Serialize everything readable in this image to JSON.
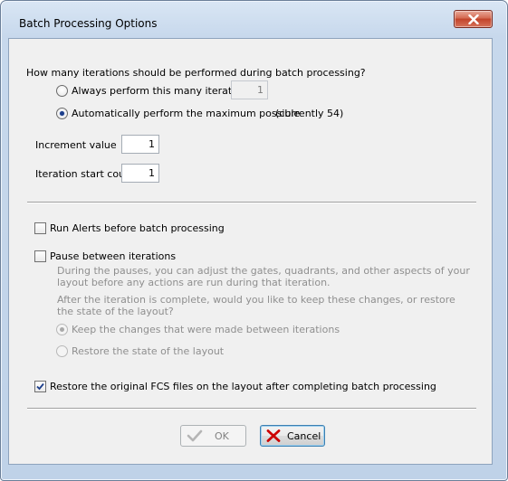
{
  "window": {
    "title": "Batch Processing Options"
  },
  "iterations": {
    "question": "How many iterations should be performed during batch processing?",
    "always_label": "Always perform this many iterations:",
    "always_value": "1",
    "auto_label": "Automatically perform the maximum possible",
    "auto_note": "(currently 54)",
    "selected": "auto"
  },
  "increment": {
    "label": "Increment value",
    "value": "1"
  },
  "start_count": {
    "label": "Iteration start count",
    "value": "1"
  },
  "alerts": {
    "label": "Run Alerts before batch processing",
    "checked": false
  },
  "pause": {
    "label": "Pause between iterations",
    "checked": false,
    "desc_line1": "During the pauses, you can adjust the gates, quadrants, and other aspects of your",
    "desc_line2": "layout before any actions are run during that iteration.",
    "desc_line3": "After the iteration is complete, would you like to keep these changes, or restore",
    "desc_line4": "the state of the layout?",
    "keep_label": "Keep the changes that were made between iterations",
    "restore_label": "Restore the state of the layout"
  },
  "restore_fcs": {
    "label": "Restore the original FCS files on the layout after completing batch processing",
    "checked": true
  },
  "buttons": {
    "ok_label": "OK",
    "cancel_label": "Cancel"
  },
  "colors": {
    "accent": "#1c3e8a",
    "cancel_icon": "#cc0000",
    "ok_icon_disabled": "#b5b5b5"
  }
}
